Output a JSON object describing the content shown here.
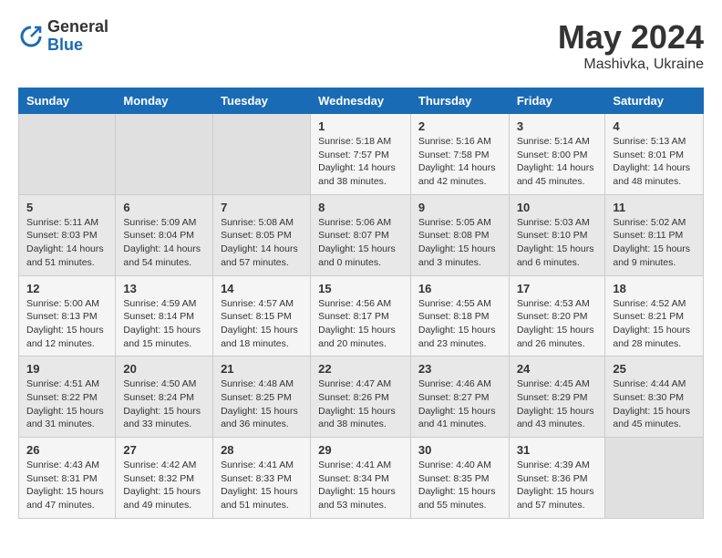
{
  "logo": {
    "general": "General",
    "blue": "Blue"
  },
  "title": {
    "month_year": "May 2024",
    "location": "Mashivka, Ukraine"
  },
  "headers": [
    "Sunday",
    "Monday",
    "Tuesday",
    "Wednesday",
    "Thursday",
    "Friday",
    "Saturday"
  ],
  "weeks": [
    [
      {
        "day": "",
        "sunrise": "",
        "sunset": "",
        "daylight": "",
        "empty": true
      },
      {
        "day": "",
        "sunrise": "",
        "sunset": "",
        "daylight": "",
        "empty": true
      },
      {
        "day": "",
        "sunrise": "",
        "sunset": "",
        "daylight": "",
        "empty": true
      },
      {
        "day": "1",
        "sunrise": "Sunrise: 5:18 AM",
        "sunset": "Sunset: 7:57 PM",
        "daylight": "Daylight: 14 hours and 38 minutes."
      },
      {
        "day": "2",
        "sunrise": "Sunrise: 5:16 AM",
        "sunset": "Sunset: 7:58 PM",
        "daylight": "Daylight: 14 hours and 42 minutes."
      },
      {
        "day": "3",
        "sunrise": "Sunrise: 5:14 AM",
        "sunset": "Sunset: 8:00 PM",
        "daylight": "Daylight: 14 hours and 45 minutes."
      },
      {
        "day": "4",
        "sunrise": "Sunrise: 5:13 AM",
        "sunset": "Sunset: 8:01 PM",
        "daylight": "Daylight: 14 hours and 48 minutes."
      }
    ],
    [
      {
        "day": "5",
        "sunrise": "Sunrise: 5:11 AM",
        "sunset": "Sunset: 8:03 PM",
        "daylight": "Daylight: 14 hours and 51 minutes."
      },
      {
        "day": "6",
        "sunrise": "Sunrise: 5:09 AM",
        "sunset": "Sunset: 8:04 PM",
        "daylight": "Daylight: 14 hours and 54 minutes."
      },
      {
        "day": "7",
        "sunrise": "Sunrise: 5:08 AM",
        "sunset": "Sunset: 8:05 PM",
        "daylight": "Daylight: 14 hours and 57 minutes."
      },
      {
        "day": "8",
        "sunrise": "Sunrise: 5:06 AM",
        "sunset": "Sunset: 8:07 PM",
        "daylight": "Daylight: 15 hours and 0 minutes."
      },
      {
        "day": "9",
        "sunrise": "Sunrise: 5:05 AM",
        "sunset": "Sunset: 8:08 PM",
        "daylight": "Daylight: 15 hours and 3 minutes."
      },
      {
        "day": "10",
        "sunrise": "Sunrise: 5:03 AM",
        "sunset": "Sunset: 8:10 PM",
        "daylight": "Daylight: 15 hours and 6 minutes."
      },
      {
        "day": "11",
        "sunrise": "Sunrise: 5:02 AM",
        "sunset": "Sunset: 8:11 PM",
        "daylight": "Daylight: 15 hours and 9 minutes."
      }
    ],
    [
      {
        "day": "12",
        "sunrise": "Sunrise: 5:00 AM",
        "sunset": "Sunset: 8:13 PM",
        "daylight": "Daylight: 15 hours and 12 minutes."
      },
      {
        "day": "13",
        "sunrise": "Sunrise: 4:59 AM",
        "sunset": "Sunset: 8:14 PM",
        "daylight": "Daylight: 15 hours and 15 minutes."
      },
      {
        "day": "14",
        "sunrise": "Sunrise: 4:57 AM",
        "sunset": "Sunset: 8:15 PM",
        "daylight": "Daylight: 15 hours and 18 minutes."
      },
      {
        "day": "15",
        "sunrise": "Sunrise: 4:56 AM",
        "sunset": "Sunset: 8:17 PM",
        "daylight": "Daylight: 15 hours and 20 minutes."
      },
      {
        "day": "16",
        "sunrise": "Sunrise: 4:55 AM",
        "sunset": "Sunset: 8:18 PM",
        "daylight": "Daylight: 15 hours and 23 minutes."
      },
      {
        "day": "17",
        "sunrise": "Sunrise: 4:53 AM",
        "sunset": "Sunset: 8:20 PM",
        "daylight": "Daylight: 15 hours and 26 minutes."
      },
      {
        "day": "18",
        "sunrise": "Sunrise: 4:52 AM",
        "sunset": "Sunset: 8:21 PM",
        "daylight": "Daylight: 15 hours and 28 minutes."
      }
    ],
    [
      {
        "day": "19",
        "sunrise": "Sunrise: 4:51 AM",
        "sunset": "Sunset: 8:22 PM",
        "daylight": "Daylight: 15 hours and 31 minutes."
      },
      {
        "day": "20",
        "sunrise": "Sunrise: 4:50 AM",
        "sunset": "Sunset: 8:24 PM",
        "daylight": "Daylight: 15 hours and 33 minutes."
      },
      {
        "day": "21",
        "sunrise": "Sunrise: 4:48 AM",
        "sunset": "Sunset: 8:25 PM",
        "daylight": "Daylight: 15 hours and 36 minutes."
      },
      {
        "day": "22",
        "sunrise": "Sunrise: 4:47 AM",
        "sunset": "Sunset: 8:26 PM",
        "daylight": "Daylight: 15 hours and 38 minutes."
      },
      {
        "day": "23",
        "sunrise": "Sunrise: 4:46 AM",
        "sunset": "Sunset: 8:27 PM",
        "daylight": "Daylight: 15 hours and 41 minutes."
      },
      {
        "day": "24",
        "sunrise": "Sunrise: 4:45 AM",
        "sunset": "Sunset: 8:29 PM",
        "daylight": "Daylight: 15 hours and 43 minutes."
      },
      {
        "day": "25",
        "sunrise": "Sunrise: 4:44 AM",
        "sunset": "Sunset: 8:30 PM",
        "daylight": "Daylight: 15 hours and 45 minutes."
      }
    ],
    [
      {
        "day": "26",
        "sunrise": "Sunrise: 4:43 AM",
        "sunset": "Sunset: 8:31 PM",
        "daylight": "Daylight: 15 hours and 47 minutes."
      },
      {
        "day": "27",
        "sunrise": "Sunrise: 4:42 AM",
        "sunset": "Sunset: 8:32 PM",
        "daylight": "Daylight: 15 hours and 49 minutes."
      },
      {
        "day": "28",
        "sunrise": "Sunrise: 4:41 AM",
        "sunset": "Sunset: 8:33 PM",
        "daylight": "Daylight: 15 hours and 51 minutes."
      },
      {
        "day": "29",
        "sunrise": "Sunrise: 4:41 AM",
        "sunset": "Sunset: 8:34 PM",
        "daylight": "Daylight: 15 hours and 53 minutes."
      },
      {
        "day": "30",
        "sunrise": "Sunrise: 4:40 AM",
        "sunset": "Sunset: 8:35 PM",
        "daylight": "Daylight: 15 hours and 55 minutes."
      },
      {
        "day": "31",
        "sunrise": "Sunrise: 4:39 AM",
        "sunset": "Sunset: 8:36 PM",
        "daylight": "Daylight: 15 hours and 57 minutes."
      },
      {
        "day": "",
        "sunrise": "",
        "sunset": "",
        "daylight": "",
        "empty": true
      }
    ]
  ]
}
